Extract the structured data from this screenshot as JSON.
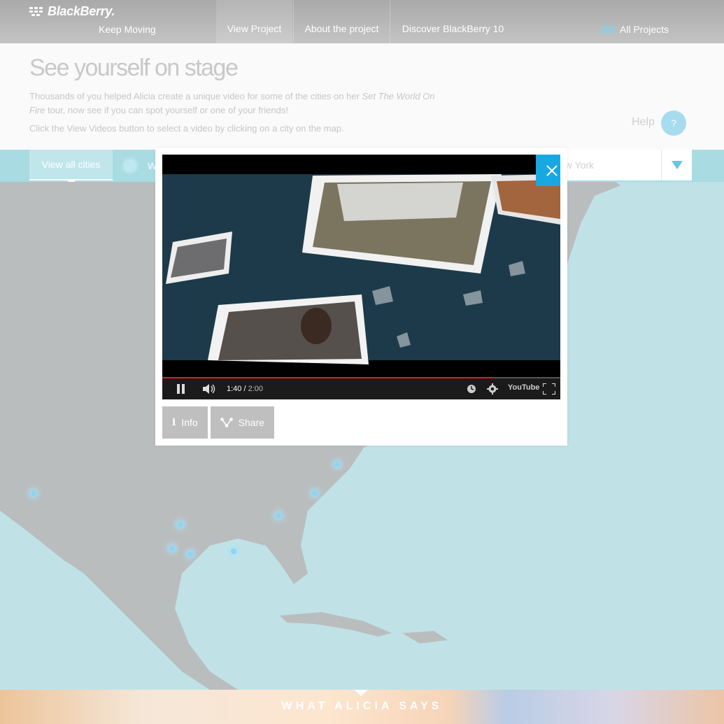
{
  "brand": {
    "name": "BlackBerry.",
    "tagline": "Keep Moving"
  },
  "nav": {
    "view_project": "View Project",
    "about": "About the project",
    "discover": "Discover BlackBerry 10",
    "all_projects": "All Projects"
  },
  "header": {
    "title": "See yourself on stage",
    "desc_pre": "Thousands of you helped Alicia create a unique video for some of the cities on her ",
    "desc_em": "Set The World On Fire",
    "desc_post": " tour, now see if you can spot yourself or one of your friends!",
    "instruction": "Click the View Videos button to select a video by clicking on a city on the map.",
    "help_label": "Help",
    "help_icon": "?"
  },
  "filter": {
    "view_all": "View all cities",
    "partial_tab": "W",
    "city_value": "ew York"
  },
  "video": {
    "current_time": "1:40",
    "duration": "2:00",
    "progress": 0.833,
    "youtube": "YouTube"
  },
  "modal_actions": {
    "info": "Info",
    "share": "Share"
  },
  "bottom": {
    "label": "WHAT ALICIA SAYS"
  },
  "colors": {
    "accent": "#18a8e0",
    "progress": "#d9201f",
    "map": "#c0e2e6"
  }
}
